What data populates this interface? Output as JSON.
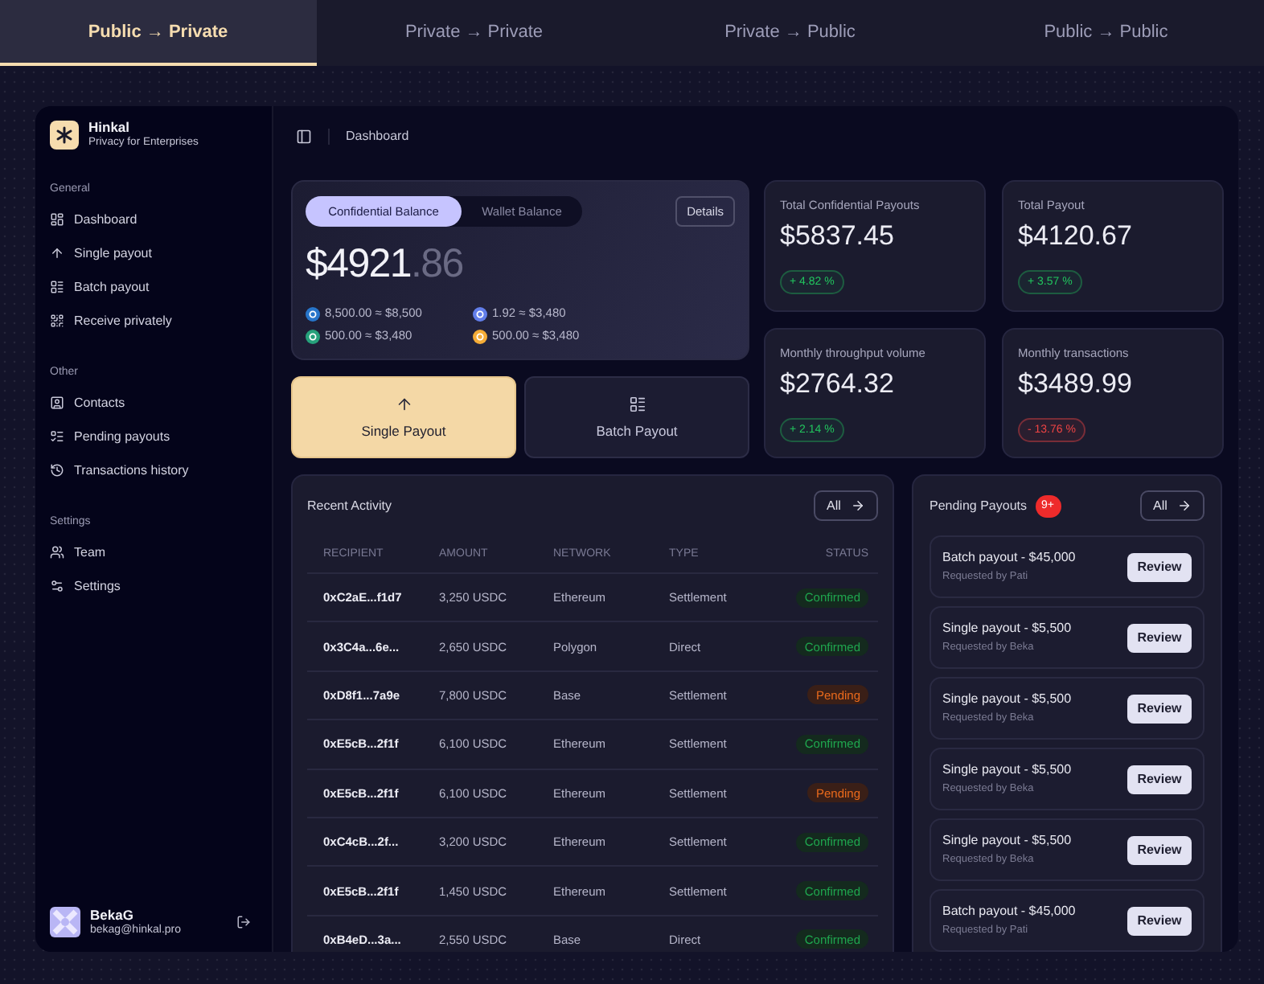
{
  "mode_tabs": [
    {
      "label": "Public → Private",
      "selected": true
    },
    {
      "label": "Private → Private",
      "selected": false
    },
    {
      "label": "Private → Public",
      "selected": false
    },
    {
      "label": "Public → Public",
      "selected": false
    }
  ],
  "sidebar": {
    "brand": {
      "name": "Hinkal",
      "tagline": "Privacy for Enterprises"
    },
    "sections": [
      {
        "title": "General",
        "items": [
          "Dashboard",
          "Single payout",
          "Batch payout",
          "Receive privately"
        ]
      },
      {
        "title": "Other",
        "items": [
          "Contacts",
          "Pending payouts",
          "Transactions history"
        ]
      },
      {
        "title": "Settings",
        "items": [
          "Team",
          "Settings"
        ]
      }
    ],
    "user": {
      "name": "BekaG",
      "email": "bekag@hinkal.pro"
    }
  },
  "header": {
    "breadcrumb": "Dashboard"
  },
  "balance": {
    "tabs": [
      {
        "label": "Confidential Balance",
        "selected": true
      },
      {
        "label": "Wallet Balance",
        "selected": false
      }
    ],
    "details_button": "Details",
    "amount": "$4921",
    "cents": ".86",
    "tokens": [
      {
        "text": "8,500.00 ≈ $8,500",
        "color": "#2775ca"
      },
      {
        "text": "1.92 ≈ $3,480",
        "color": "#627eea"
      },
      {
        "text": "500.00 ≈ $3,480",
        "color": "#26a17b"
      },
      {
        "text": "500.00 ≈ $3,480",
        "color": "#f5ac37"
      }
    ]
  },
  "actions": [
    {
      "label": "Single Payout",
      "kind": "primary"
    },
    {
      "label": "Batch Payout",
      "kind": "secondary"
    }
  ],
  "stats": [
    {
      "label": "Total Confidential Payouts",
      "value": "$5837.45",
      "change": "+ 4.82 %",
      "kind": "gain"
    },
    {
      "label": "Total Payout",
      "value": "$4120.67",
      "change": "+ 3.57 %",
      "kind": "gain"
    },
    {
      "label": "Monthly throughput volume",
      "value": "$2764.32",
      "change": "+ 2.14 %",
      "kind": "gain"
    },
    {
      "label": "Monthly transactions",
      "value": "$3489.99",
      "change": "- 13.76 %",
      "kind": "loss"
    }
  ],
  "recent_activity": {
    "title": "Recent Activity",
    "all_button": "All",
    "columns": [
      "RECIPIENT",
      "AMOUNT",
      "NETWORK",
      "TYPE",
      "STATUS"
    ],
    "rows": [
      {
        "recipient": "0xC2aE...f1d7",
        "amount": "3,250 USDC",
        "network": "Ethereum",
        "type": "Settlement",
        "status": {
          "label": "Confirmed",
          "kind": "confirmed"
        }
      },
      {
        "recipient": "0x3C4a...6e...",
        "amount": "2,650 USDC",
        "network": "Polygon",
        "type": "Direct",
        "status": {
          "label": "Confirmed",
          "kind": "confirmed"
        }
      },
      {
        "recipient": "0xD8f1...7a9e",
        "amount": "7,800 USDC",
        "network": "Base",
        "type": "Settlement",
        "status": {
          "label": "Pending",
          "kind": "pending"
        }
      },
      {
        "recipient": "0xE5cB...2f1f",
        "amount": "6,100 USDC",
        "network": "Ethereum",
        "type": "Settlement",
        "status": {
          "label": "Confirmed",
          "kind": "confirmed"
        }
      },
      {
        "recipient": "0xE5cB...2f1f",
        "amount": "6,100 USDC",
        "network": "Ethereum",
        "type": "Settlement",
        "status": {
          "label": "Pending",
          "kind": "pending"
        }
      },
      {
        "recipient": "0xC4cB...2f...",
        "amount": "3,200 USDC",
        "network": "Ethereum",
        "type": "Settlement",
        "status": {
          "label": "Confirmed",
          "kind": "confirmed"
        }
      },
      {
        "recipient": "0xE5cB...2f1f",
        "amount": "1,450 USDC",
        "network": "Ethereum",
        "type": "Settlement",
        "status": {
          "label": "Confirmed",
          "kind": "confirmed"
        }
      },
      {
        "recipient": "0xB4eD...3a...",
        "amount": "2,550 USDC",
        "network": "Base",
        "type": "Direct",
        "status": {
          "label": "Confirmed",
          "kind": "confirmed"
        }
      }
    ]
  },
  "pending_payouts": {
    "title": "Pending Payouts",
    "badge": "9+",
    "all_button": "All",
    "items": [
      {
        "title": "Batch payout - $45,000",
        "requester": "Requested by Pati",
        "button": "Review"
      },
      {
        "title": "Single payout - $5,500",
        "requester": "Requested by Beka",
        "button": "Review"
      },
      {
        "title": "Single payout - $5,500",
        "requester": "Requested by Beka",
        "button": "Review"
      },
      {
        "title": "Single payout - $5,500",
        "requester": "Requested by Beka",
        "button": "Review"
      },
      {
        "title": "Single payout - $5,500",
        "requester": "Requested by Beka",
        "button": "Review"
      },
      {
        "title": "Batch payout - $45,000",
        "requester": "Requested by Pati",
        "button": "Review"
      }
    ]
  }
}
